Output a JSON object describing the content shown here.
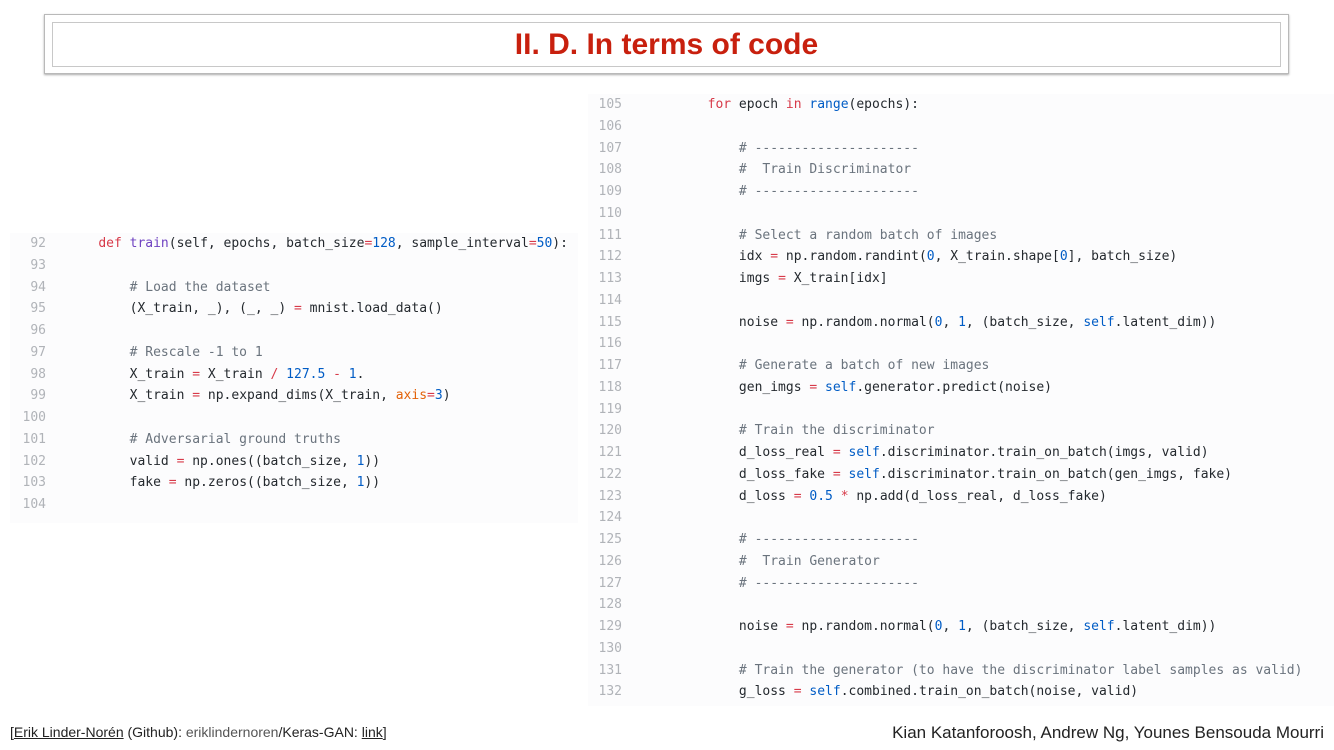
{
  "title": "II. D. In terms of code",
  "code_left": [
    {
      "num": "92",
      "tokens": [
        [
          "t",
          "    "
        ],
        [
          "k",
          "def"
        ],
        [
          "t",
          " "
        ],
        [
          "f",
          "train"
        ],
        [
          "t",
          "(self, epochs, batch_size"
        ],
        [
          "o",
          "="
        ],
        [
          "n",
          "128"
        ],
        [
          "t",
          ", sample_interval"
        ],
        [
          "o",
          "="
        ],
        [
          "n",
          "50"
        ],
        [
          "t",
          "):"
        ]
      ]
    },
    {
      "num": "93",
      "tokens": []
    },
    {
      "num": "94",
      "tokens": [
        [
          "c",
          "        # Load the dataset"
        ]
      ]
    },
    {
      "num": "95",
      "tokens": [
        [
          "t",
          "        (X_train, _), (_, _) "
        ],
        [
          "o",
          "="
        ],
        [
          "t",
          " mnist.load_data()"
        ]
      ]
    },
    {
      "num": "96",
      "tokens": []
    },
    {
      "num": "97",
      "tokens": [
        [
          "c",
          "        # Rescale -1 to 1"
        ]
      ]
    },
    {
      "num": "98",
      "tokens": [
        [
          "t",
          "        X_train "
        ],
        [
          "o",
          "="
        ],
        [
          "t",
          " X_train "
        ],
        [
          "o",
          "/"
        ],
        [
          "t",
          " "
        ],
        [
          "n",
          "127.5"
        ],
        [
          "t",
          " "
        ],
        [
          "o",
          "-"
        ],
        [
          "t",
          " "
        ],
        [
          "n",
          "1"
        ],
        [
          "t",
          "."
        ]
      ]
    },
    {
      "num": "99",
      "tokens": [
        [
          "t",
          "        X_train "
        ],
        [
          "o",
          "="
        ],
        [
          "t",
          " np.expand_dims(X_train, "
        ],
        [
          "p",
          "axis"
        ],
        [
          "o",
          "="
        ],
        [
          "n",
          "3"
        ],
        [
          "t",
          ")"
        ]
      ]
    },
    {
      "num": "100",
      "tokens": []
    },
    {
      "num": "101",
      "tokens": [
        [
          "c",
          "        # Adversarial ground truths"
        ]
      ]
    },
    {
      "num": "102",
      "tokens": [
        [
          "t",
          "        valid "
        ],
        [
          "o",
          "="
        ],
        [
          "t",
          " np.ones((batch_size, "
        ],
        [
          "n",
          "1"
        ],
        [
          "t",
          "))"
        ]
      ]
    },
    {
      "num": "103",
      "tokens": [
        [
          "t",
          "        fake "
        ],
        [
          "o",
          "="
        ],
        [
          "t",
          " np.zeros((batch_size, "
        ],
        [
          "n",
          "1"
        ],
        [
          "t",
          "))"
        ]
      ]
    },
    {
      "num": "104",
      "tokens": []
    }
  ],
  "code_right": [
    {
      "num": "105",
      "tokens": [
        [
          "t",
          "        "
        ],
        [
          "k",
          "for"
        ],
        [
          "t",
          " epoch "
        ],
        [
          "k",
          "in"
        ],
        [
          "t",
          " "
        ],
        [
          "n",
          "range"
        ],
        [
          "t",
          "(epochs):"
        ]
      ]
    },
    {
      "num": "106",
      "tokens": []
    },
    {
      "num": "107",
      "tokens": [
        [
          "c",
          "            # ---------------------"
        ]
      ]
    },
    {
      "num": "108",
      "tokens": [
        [
          "c",
          "            #  Train Discriminator"
        ]
      ]
    },
    {
      "num": "109",
      "tokens": [
        [
          "c",
          "            # ---------------------"
        ]
      ]
    },
    {
      "num": "110",
      "tokens": []
    },
    {
      "num": "111",
      "tokens": [
        [
          "c",
          "            # Select a random batch of images"
        ]
      ]
    },
    {
      "num": "112",
      "tokens": [
        [
          "t",
          "            idx "
        ],
        [
          "o",
          "="
        ],
        [
          "t",
          " np.random.randint("
        ],
        [
          "n",
          "0"
        ],
        [
          "t",
          ", X_train.shape["
        ],
        [
          "n",
          "0"
        ],
        [
          "t",
          "], batch_size)"
        ]
      ]
    },
    {
      "num": "113",
      "tokens": [
        [
          "t",
          "            imgs "
        ],
        [
          "o",
          "="
        ],
        [
          "t",
          " X_train[idx]"
        ]
      ]
    },
    {
      "num": "114",
      "tokens": []
    },
    {
      "num": "115",
      "tokens": [
        [
          "t",
          "            noise "
        ],
        [
          "o",
          "="
        ],
        [
          "t",
          " np.random.normal("
        ],
        [
          "n",
          "0"
        ],
        [
          "t",
          ", "
        ],
        [
          "n",
          "1"
        ],
        [
          "t",
          ", (batch_size, "
        ],
        [
          "n",
          "self"
        ],
        [
          "t",
          ".latent_dim))"
        ]
      ]
    },
    {
      "num": "116",
      "tokens": []
    },
    {
      "num": "117",
      "tokens": [
        [
          "c",
          "            # Generate a batch of new images"
        ]
      ]
    },
    {
      "num": "118",
      "tokens": [
        [
          "t",
          "            gen_imgs "
        ],
        [
          "o",
          "="
        ],
        [
          "t",
          " "
        ],
        [
          "n",
          "self"
        ],
        [
          "t",
          ".generator.predict(noise)"
        ]
      ]
    },
    {
      "num": "119",
      "tokens": []
    },
    {
      "num": "120",
      "tokens": [
        [
          "c",
          "            # Train the discriminator"
        ]
      ]
    },
    {
      "num": "121",
      "tokens": [
        [
          "t",
          "            d_loss_real "
        ],
        [
          "o",
          "="
        ],
        [
          "t",
          " "
        ],
        [
          "n",
          "self"
        ],
        [
          "t",
          ".discriminator.train_on_batch(imgs, valid)"
        ]
      ]
    },
    {
      "num": "122",
      "tokens": [
        [
          "t",
          "            d_loss_fake "
        ],
        [
          "o",
          "="
        ],
        [
          "t",
          " "
        ],
        [
          "n",
          "self"
        ],
        [
          "t",
          ".discriminator.train_on_batch(gen_imgs, fake)"
        ]
      ]
    },
    {
      "num": "123",
      "tokens": [
        [
          "t",
          "            d_loss "
        ],
        [
          "o",
          "="
        ],
        [
          "t",
          " "
        ],
        [
          "n",
          "0.5"
        ],
        [
          "t",
          " "
        ],
        [
          "o",
          "*"
        ],
        [
          "t",
          " np.add(d_loss_real, d_loss_fake)"
        ]
      ]
    },
    {
      "num": "124",
      "tokens": []
    },
    {
      "num": "125",
      "tokens": [
        [
          "c",
          "            # ---------------------"
        ]
      ]
    },
    {
      "num": "126",
      "tokens": [
        [
          "c",
          "            #  Train Generator"
        ]
      ]
    },
    {
      "num": "127",
      "tokens": [
        [
          "c",
          "            # ---------------------"
        ]
      ]
    },
    {
      "num": "128",
      "tokens": []
    },
    {
      "num": "129",
      "tokens": [
        [
          "t",
          "            noise "
        ],
        [
          "o",
          "="
        ],
        [
          "t",
          " np.random.normal("
        ],
        [
          "n",
          "0"
        ],
        [
          "t",
          ", "
        ],
        [
          "n",
          "1"
        ],
        [
          "t",
          ", (batch_size, "
        ],
        [
          "n",
          "self"
        ],
        [
          "t",
          ".latent_dim))"
        ]
      ]
    },
    {
      "num": "130",
      "tokens": []
    },
    {
      "num": "131",
      "tokens": [
        [
          "c",
          "            # Train the generator (to have the discriminator label samples as valid)"
        ]
      ]
    },
    {
      "num": "132",
      "tokens": [
        [
          "t",
          "            g_loss "
        ],
        [
          "o",
          "="
        ],
        [
          "t",
          " "
        ],
        [
          "n",
          "self"
        ],
        [
          "t",
          ".combined.train_on_batch(noise, valid)"
        ]
      ]
    }
  ],
  "footer": {
    "open": "[",
    "author_link": "Erik Linder-Norén",
    "github": " (Github): ",
    "repo_user": "eriklindernoren",
    "repo_name": "/Keras-GAN: ",
    "link": "link",
    "close": "]",
    "credits": "Kian Katanforoosh, Andrew Ng, Younes Bensouda Mourri"
  }
}
